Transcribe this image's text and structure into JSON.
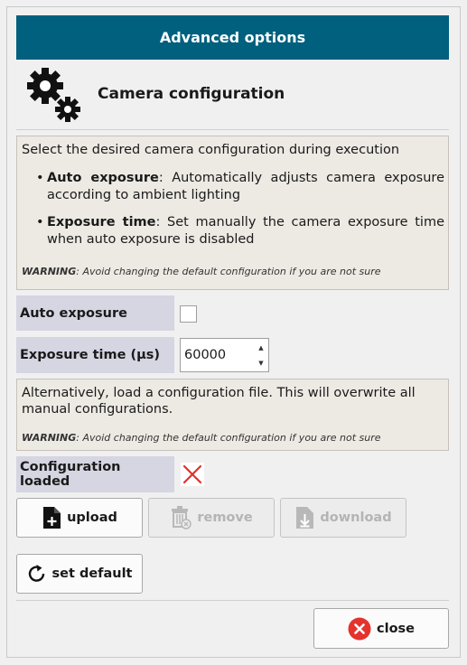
{
  "header": {
    "title": "Advanced options"
  },
  "section": {
    "title": "Camera configuration",
    "icon": "gears-icon"
  },
  "info": {
    "intro": "Select the desired camera configuration during execution",
    "bullets": [
      {
        "term": "Auto exposure",
        "text": ": Automatically adjusts camera exposure according to ambient lighting"
      },
      {
        "term": "Exposure time",
        "text": ": Set manually the camera exposure time when auto exposure is disabled"
      }
    ],
    "warning_label": "WARNING",
    "warning_text": ": Avoid changing the default configuration if you are not sure"
  },
  "fields": {
    "auto_exposure_label": "Auto exposure",
    "auto_exposure_checked": false,
    "exposure_time_label": "Exposure time (µs)",
    "exposure_time_value": "60000"
  },
  "file_info": {
    "text": "Alternatively, load a configuration file. This will overwrite all manual configurations.",
    "warning_label": "WARNING",
    "warning_text": ": Avoid changing the default configuration if you are not sure"
  },
  "config_status": {
    "label": "Configuration loaded",
    "loaded": false,
    "icon": "red-x-icon",
    "icon_color": "#e0302a"
  },
  "buttons": {
    "upload": "upload",
    "remove": "remove",
    "download": "download",
    "set_default": "set default",
    "close": "close"
  },
  "colors": {
    "header_bg": "#00607e",
    "label_bg": "#d6d5e2",
    "info_bg": "#edeae4",
    "close_icon": "#e5322d"
  }
}
